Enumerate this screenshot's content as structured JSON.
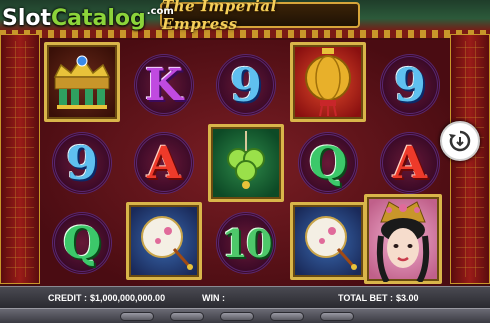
{
  "brand": {
    "slot": "Slot",
    "catalog": "Catalog",
    "com": ".com"
  },
  "game": {
    "title": "The Imperial Empress"
  },
  "reels": [
    [
      "crown",
      "9",
      "q",
      "empress"
    ],
    [
      "k",
      "a",
      "fan"
    ],
    [
      "9",
      "jade",
      "10"
    ],
    [
      "lantern",
      "q",
      "fan"
    ],
    [
      "9",
      "a",
      "empress"
    ]
  ],
  "symbols": {
    "nine": "9",
    "ten": "10",
    "queen": "Q",
    "ace": "A",
    "king": "K"
  },
  "bottom_bar": {
    "credit_label": "CREDIT :",
    "credit_value": "$1,000,000,000.00",
    "win_label": "WIN :",
    "win_value": "",
    "total_bet_label": "TOTAL BET :",
    "total_bet_value": "$3.00"
  },
  "icons": {
    "spin": "circular-arrow-icon"
  },
  "colors": {
    "brand_green": "#8cd43a",
    "title_gold": "#f4cf5a",
    "frame_gold": "#d9b54a"
  }
}
